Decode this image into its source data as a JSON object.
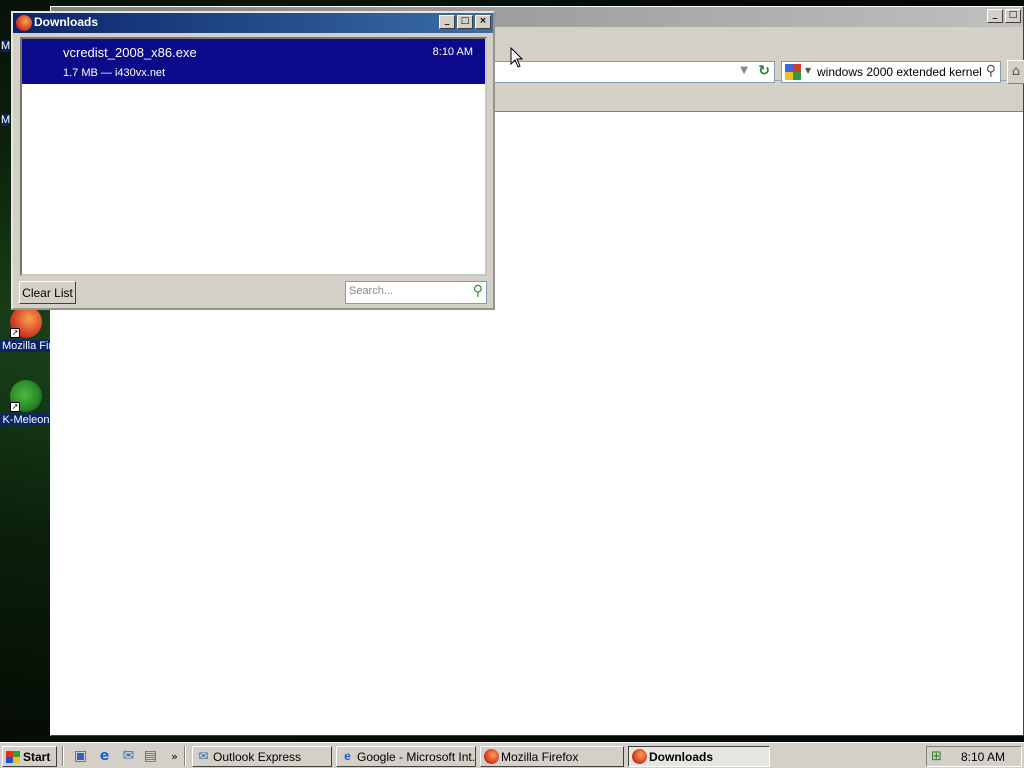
{
  "desktop": {
    "icons": [
      {
        "label": "Mozilla Fire",
        "icon": "firefox-icon"
      },
      {
        "label": "K-Meleon",
        "icon": "k-meleon-icon"
      }
    ],
    "edge_labels": [
      "M",
      "M"
    ]
  },
  "firefox_window": {
    "search_engine_icon": "google-icon",
    "search_query": "windows 2000 extended kernel"
  },
  "downloads_window": {
    "title": "Downloads",
    "items": [
      {
        "filename": "vcredist_2008_x86.exe",
        "meta": "1.7 MB — i430vx.net",
        "time": "8:10 AM"
      }
    ],
    "clear_list_label": "Clear List",
    "search_placeholder": "Search..."
  },
  "taskbar": {
    "start_label": "Start",
    "quick_launch": [
      "show-desktop-icon",
      "internet-explorer-icon",
      "outlook-express-icon",
      "windows-explorer-icon"
    ],
    "overflow": "»",
    "tasks": [
      {
        "label": "Outlook Express",
        "icon": "outlook-express-icon",
        "active": false
      },
      {
        "label": "Google - Microsoft Int...",
        "icon": "internet-explorer-icon",
        "active": false
      },
      {
        "label": "Mozilla Firefox",
        "icon": "firefox-icon",
        "active": false
      },
      {
        "label": "Downloads",
        "icon": "firefox-icon",
        "active": true
      }
    ],
    "clock": "8:10 AM"
  },
  "colors": {
    "selection": "#0a0a8a",
    "titlebar_active": "#0a246a",
    "window_face": "#d4d0c8"
  }
}
